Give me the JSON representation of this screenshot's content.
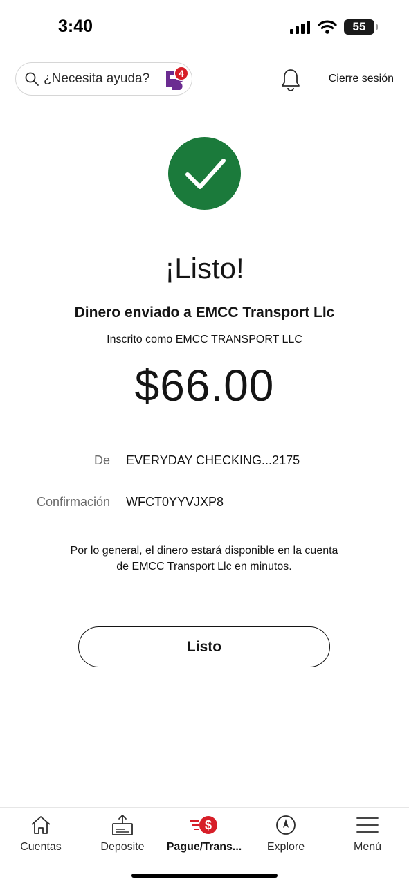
{
  "status_bar": {
    "time": "3:40",
    "battery": "55"
  },
  "header": {
    "search_placeholder": "¿Necesita ayuda?",
    "notification_count": "4",
    "logout_label": "Cierre sesión"
  },
  "confirmation": {
    "headline": "¡Listo!",
    "sent_to": "Dinero enviado a EMCC Transport Llc",
    "registered_as": "Inscrito como EMCC TRANSPORT LLC",
    "amount": "$66.00",
    "details": [
      {
        "label": "De",
        "value": "EVERYDAY CHECKING...2175"
      },
      {
        "label": "Confirmación",
        "value": "WFCT0YYVJXP8"
      }
    ],
    "note": "Por lo general, el dinero estará disponible en la cuenta de EMCC Transport Llc en minutos.",
    "done_label": "Listo"
  },
  "bottom_nav": {
    "items": [
      {
        "label": "Cuentas",
        "icon": "home-icon"
      },
      {
        "label": "Deposite",
        "icon": "deposit-icon"
      },
      {
        "label": "Pague/Trans...",
        "icon": "pay-transfer-icon",
        "active": true
      },
      {
        "label": "Explore",
        "icon": "compass-icon"
      },
      {
        "label": "Menú",
        "icon": "menu-icon"
      }
    ]
  },
  "colors": {
    "success_green": "#1b7a3b",
    "brand_red": "#d71e28",
    "fargo_purple": "#6b2c91",
    "text": "#141414",
    "muted": "#6b6b6b"
  }
}
